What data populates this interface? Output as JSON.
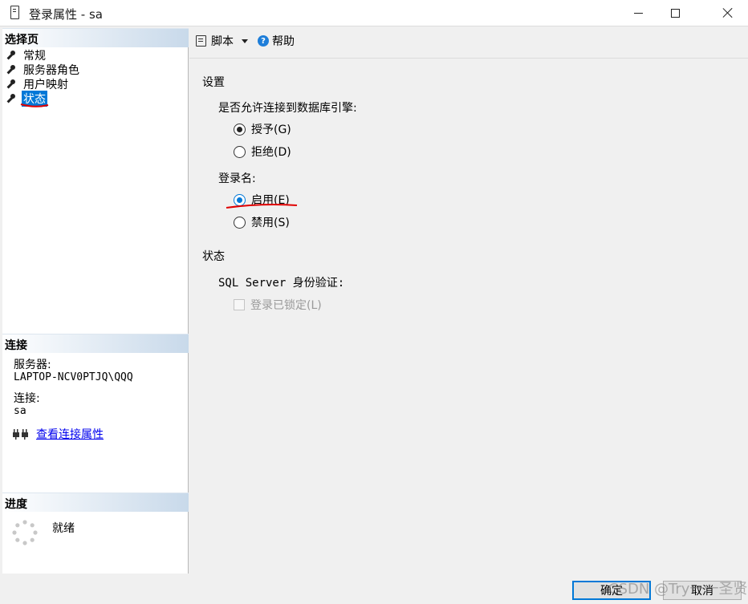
{
  "window": {
    "title": "登录属性 - sa"
  },
  "left": {
    "select_page_header": "选择页",
    "pages": [
      {
        "label": "常规",
        "selected": false
      },
      {
        "label": "服务器角色",
        "selected": false
      },
      {
        "label": "用户映射",
        "selected": false
      },
      {
        "label": "状态",
        "selected": true
      }
    ],
    "connection_header": "连接",
    "server_label": "服务器:",
    "server_value": "LAPTOP-NCV0PTJQ\\QQQ",
    "connection_label": "连接:",
    "connection_value": "sa",
    "view_connection_properties": "查看连接属性",
    "progress_header": "进度",
    "progress_status": "就绪"
  },
  "toolbar": {
    "script_label": "脚本",
    "help_label": "帮助"
  },
  "settings": {
    "section_title": "设置",
    "permission_question": "是否允许连接到数据库引擎:",
    "grant_label": "授予(G)",
    "deny_label": "拒绝(D)",
    "permission_selected": "grant",
    "login_label": "登录名:",
    "enable_label": "启用(E)",
    "disable_label": "禁用(S)",
    "login_selected": "enable"
  },
  "status": {
    "section_title": "状态",
    "auth_label": "SQL Server 身份验证:",
    "locked_label": "登录已锁定(L)",
    "locked_checked": false
  },
  "buttons": {
    "ok": "确定",
    "cancel": "取消"
  },
  "watermark": "CSDN @Try一一圣贤",
  "colors": {
    "accent": "#0078d7",
    "annotation_red": "#e00000"
  }
}
